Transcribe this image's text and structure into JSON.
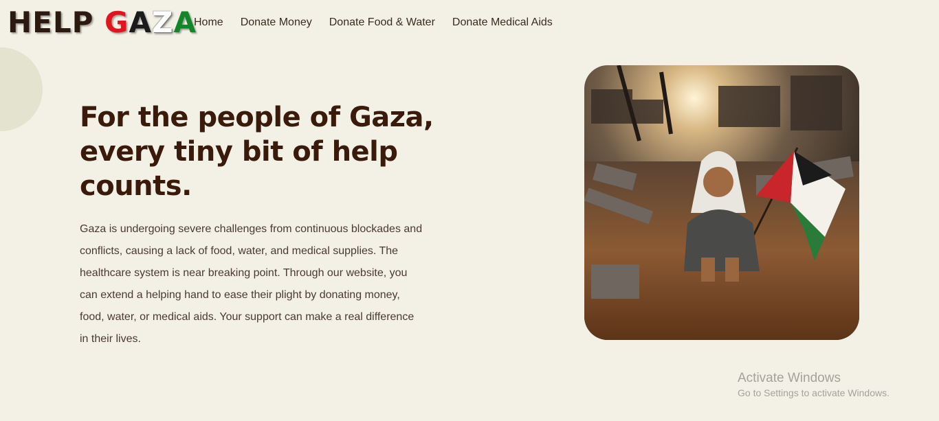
{
  "header": {
    "logo": {
      "word1": "HELP",
      "letters": [
        "G",
        "A",
        "Z",
        "A"
      ],
      "colors": {
        "help": "#2c1a10",
        "g": "#e0161e",
        "a1": "#1b1b1b",
        "z": "#ffffff",
        "a2": "#14862a"
      }
    },
    "nav": [
      {
        "label": "Home"
      },
      {
        "label": "Donate Money"
      },
      {
        "label": "Donate Food & Water"
      },
      {
        "label": "Donate Medical Aids"
      }
    ]
  },
  "hero": {
    "headline": "For the people of Gaza, every tiny bit of help counts.",
    "body": "Gaza is undergoing severe challenges from continuous blockades and conflicts, causing a lack of food, water, and medical supplies. The healthcare system is near breaking point. Through our website, you can extend a helping hand to ease their plight by donating money, food, water, or medical aids. Your support can make a real difference in their lives.",
    "image": {
      "subject": "child-with-palestinian-flag-in-rubble"
    }
  },
  "watermark": {
    "title": "Activate Windows",
    "subtitle": "Go to Settings to activate Windows."
  },
  "colors": {
    "background": "#f3f1e6",
    "headline": "#3a1a0a",
    "text": "#4a3a2e",
    "deco_circle": "#e4e3d0"
  }
}
